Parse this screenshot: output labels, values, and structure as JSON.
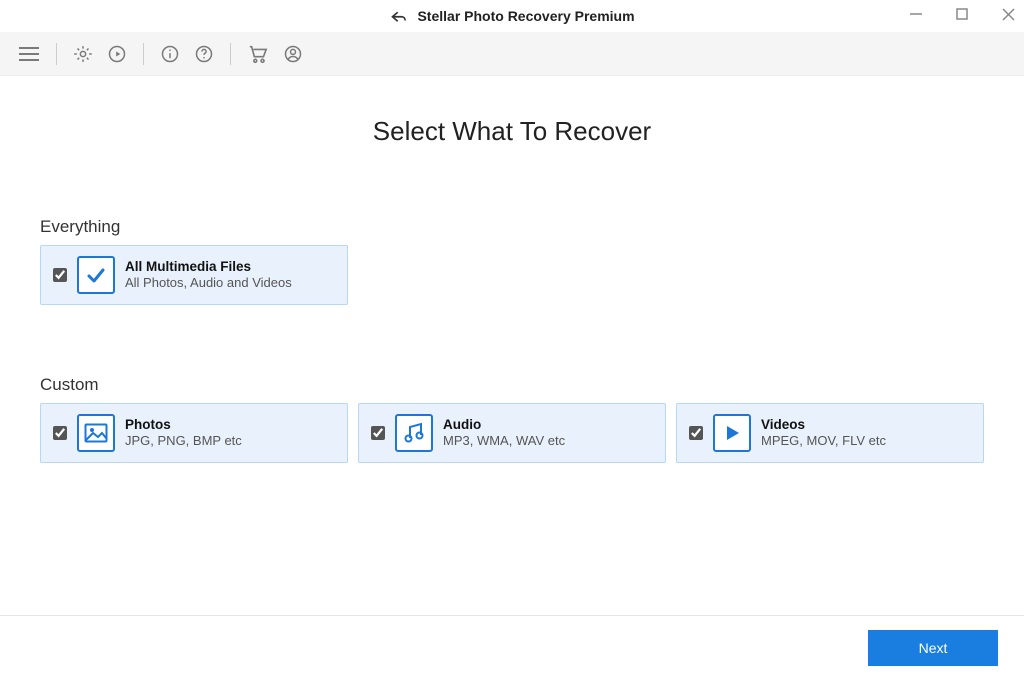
{
  "window": {
    "title": "Stellar Photo Recovery  Premium"
  },
  "main": {
    "heading": "Select What To Recover"
  },
  "sections": {
    "everything": {
      "label": "Everything",
      "card": {
        "checked": true,
        "title": "All Multimedia Files",
        "sub": "All Photos, Audio and Videos"
      }
    },
    "custom": {
      "label": "Custom",
      "cards": [
        {
          "checked": true,
          "title": "Photos",
          "sub": "JPG, PNG, BMP etc"
        },
        {
          "checked": true,
          "title": "Audio",
          "sub": "MP3, WMA, WAV etc"
        },
        {
          "checked": true,
          "title": "Videos",
          "sub": "MPEG, MOV, FLV etc"
        }
      ]
    }
  },
  "footer": {
    "next_label": "Next"
  }
}
